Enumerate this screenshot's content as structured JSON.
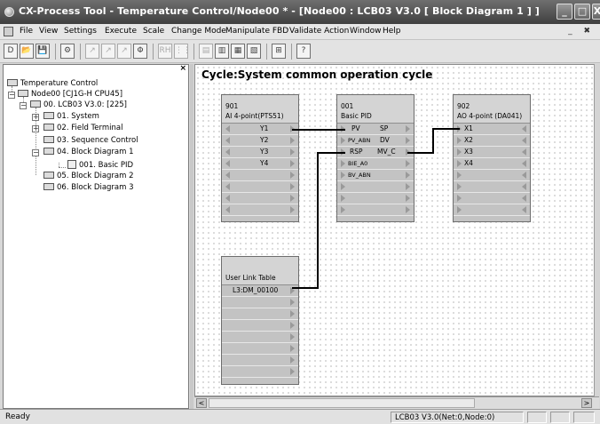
{
  "window": {
    "title": "CX-Process Tool - Temperature Control/Node00 * - [Node00 : LCB03 V3.0 [ Block Diagram 1 ] ]",
    "minimize_glyph": "_",
    "maximize_glyph": "□",
    "close_glyph": "X"
  },
  "menu": {
    "items": [
      "File",
      "View",
      "Settings",
      "Execute",
      "Scale",
      "Change Mode",
      "Manipulate FBD",
      "Validate Action",
      "Window",
      "Help"
    ],
    "mdi_controls": "_ ✖"
  },
  "toolbar": {
    "buttons": [
      {
        "name": "new-icon",
        "glyph": "D"
      },
      {
        "name": "open-icon",
        "glyph": "📂"
      },
      {
        "name": "save-icon",
        "glyph": "💾"
      },
      {
        "name": "properties-icon",
        "glyph": "⚙"
      },
      {
        "name": "wire-tool-icon",
        "glyph": "↗"
      },
      {
        "name": "wire-tool-2-icon",
        "glyph": "↗"
      },
      {
        "name": "wire-tool-3-icon",
        "glyph": "↗"
      },
      {
        "name": "function-block-icon",
        "glyph": "Φ"
      },
      {
        "name": "rh-icon",
        "glyph": "RH"
      },
      {
        "name": "step-icon",
        "glyph": "⋮⋮"
      },
      {
        "name": "layout-1-icon",
        "glyph": "▤"
      },
      {
        "name": "layout-2-icon",
        "glyph": "▥"
      },
      {
        "name": "layout-3-icon",
        "glyph": "▦"
      },
      {
        "name": "layout-4-icon",
        "glyph": "▧"
      },
      {
        "name": "grid-icon",
        "glyph": "⊞"
      },
      {
        "name": "help-icon",
        "glyph": "?"
      }
    ]
  },
  "tree": {
    "close_glyph": "×",
    "root": "Temperature Control",
    "node": "Node00 [CJ1G-H CPU45]",
    "lcb": "00. LCB03 V3.0: [225]",
    "items": [
      "01. System",
      "02. Field Terminal",
      "03. Sequence Control",
      "04. Block Diagram 1",
      "001. Basic PID",
      "05. Block Diagram 2",
      "06. Block Diagram 3"
    ]
  },
  "diagram": {
    "cycle_title": "Cycle:System common operation cycle",
    "blocks": {
      "ai": {
        "number": "901",
        "name": "AI 4-point(PTS51)",
        "outputs": [
          "Y1",
          "Y2",
          "Y3",
          "Y4"
        ]
      },
      "pid": {
        "number": "001",
        "name": "Basic PID",
        "inputs": [
          "PV",
          "PV_ABN",
          "RSP",
          "BIE_A0",
          "BV_ABN"
        ],
        "outputs": [
          "SP",
          "DV",
          "MV_C"
        ]
      },
      "ao": {
        "number": "902",
        "name": "AO 4-point (DA041)",
        "inputs": [
          "X1",
          "X2",
          "X3",
          "X4"
        ]
      },
      "link": {
        "name": "User Link Table",
        "entry": "L3:DM_00100"
      }
    }
  },
  "status": {
    "ready": "Ready",
    "node_info": "LCB03 V3.0(Net:0,Node:0)"
  }
}
